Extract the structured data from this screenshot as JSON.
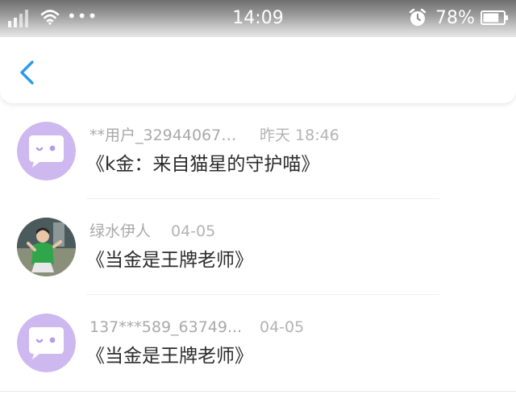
{
  "status_bar": {
    "time": "14:09",
    "battery_percent": "78%",
    "battery_level": 0.78,
    "more_indicator": "•••",
    "icons": [
      "signal-icon",
      "wifi-icon",
      "alarm-clock-icon",
      "battery-icon"
    ]
  },
  "header": {
    "back_icon": "chevron-left-icon",
    "accent_color": "#2a9be8"
  },
  "comments": [
    {
      "avatar": "default-chat-avatar",
      "user": "**用户_32944067…",
      "date": "昨天 18:46",
      "message": "《k金：来自猫星的守护喵》"
    },
    {
      "avatar": "photo-avatar",
      "user": "绿水伊人",
      "date": "04-05",
      "message": "《当金是王牌老师》"
    },
    {
      "avatar": "default-chat-avatar",
      "user": "137***589_63749...",
      "date": "04-05",
      "message": "《当金是王牌老师》"
    }
  ],
  "colors": {
    "avatar_bg": "#cdb8f0",
    "name_text": "#a9a9a9",
    "message_text": "#2b2b2b"
  }
}
